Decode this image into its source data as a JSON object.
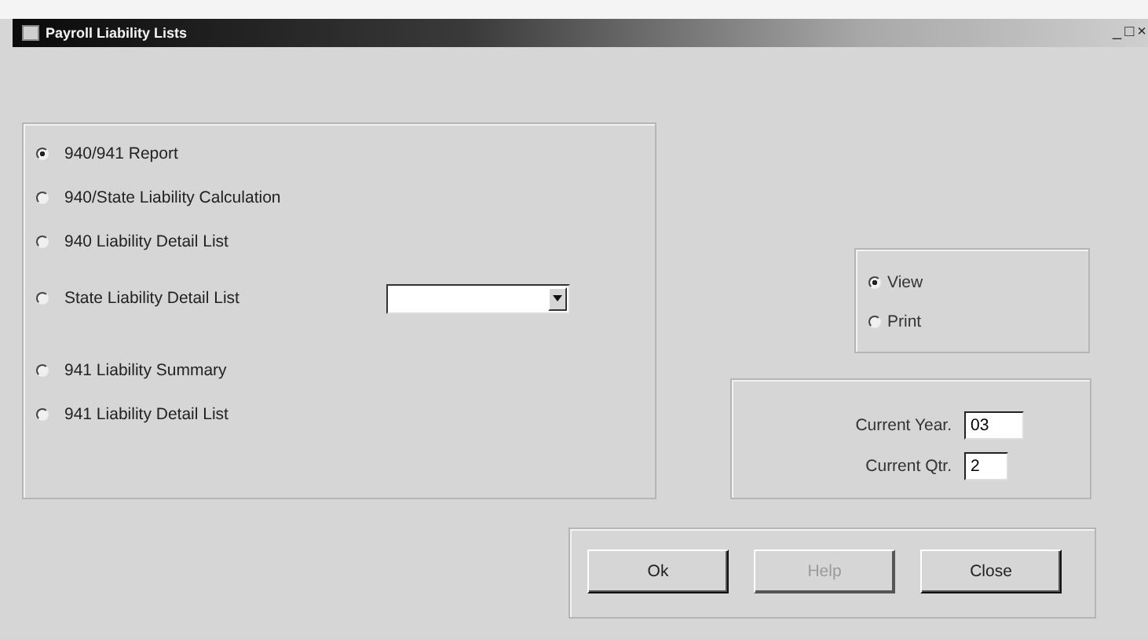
{
  "window": {
    "title": "Payroll Liability Lists",
    "controls": [
      "_",
      "□",
      "×"
    ]
  },
  "report_options": [
    {
      "label": "940/941 Report",
      "selected": true,
      "kind": "radio"
    },
    {
      "label": "940/State Liability Calculation",
      "selected": false,
      "kind": "radio"
    },
    {
      "label": "940 Liability Detail List",
      "selected": false,
      "kind": "radio"
    },
    {
      "label": "State Liability Detail List",
      "selected": false,
      "kind": "dropdown"
    },
    {
      "label": "941 Liability Summary",
      "selected": false,
      "kind": "radio"
    },
    {
      "label": "941 Liability Detail List",
      "selected": false,
      "kind": "radio"
    }
  ],
  "output_options": [
    {
      "label": "View",
      "selected": true
    },
    {
      "label": "Print",
      "selected": false
    }
  ],
  "period_fields": [
    {
      "label": "Current Year.",
      "value": "03"
    },
    {
      "label": "Current Qtr.",
      "value": "2"
    }
  ],
  "buttons": [
    {
      "label": "Ok",
      "disabled": false
    },
    {
      "label": "Help",
      "disabled": true
    },
    {
      "label": "Close",
      "disabled": false
    }
  ]
}
